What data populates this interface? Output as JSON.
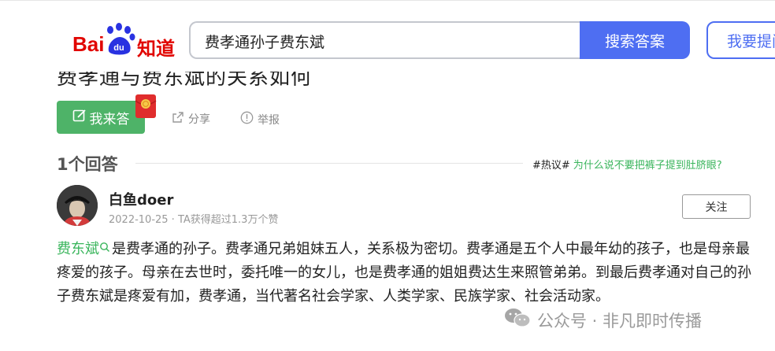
{
  "question": {
    "title": "费孝通与费东斌的关系如何"
  },
  "header": {
    "logo_bai": "Bai",
    "logo_du": "du",
    "logo_zhidao": "知道",
    "search_value": "费孝通孙子费东斌",
    "search_button": "搜索答案",
    "ask_button": "我要提问"
  },
  "actions": {
    "answer_label": "我来答",
    "share_label": "分享",
    "report_label": "举报"
  },
  "answers": {
    "count_label": "1个回答",
    "hot_tag": "#热议#",
    "hot_link": "为什么说不要把裤子提到肚脐眼?"
  },
  "answer": {
    "username": "白鱼doer",
    "meta": "2022-10-25 · TA获得超过1.3万个赞",
    "follow_label": "关注",
    "keyword": "费东斌",
    "body": "是费孝通的孙子。费孝通兄弟姐妹五人，关系极为密切。费孝通是五个人中最年幼的孩子，也是母亲最疼爱的孩子。母亲在去世时，委托唯一的女儿，也是费孝通的姐姐费达生来照管弟弟。到最后费孝通对自己的孙子费东斌是疼爱有加，费孝通，当代著名社会学家、人类学家、民族学家、社会活动家。"
  },
  "watermark": {
    "text": "公众号 · 非凡即时传播"
  },
  "colors": {
    "brand_red": "#e10602",
    "search_blue": "#4e6ef2",
    "answer_green": "#4eb368",
    "link_green": "#3ab55c"
  }
}
